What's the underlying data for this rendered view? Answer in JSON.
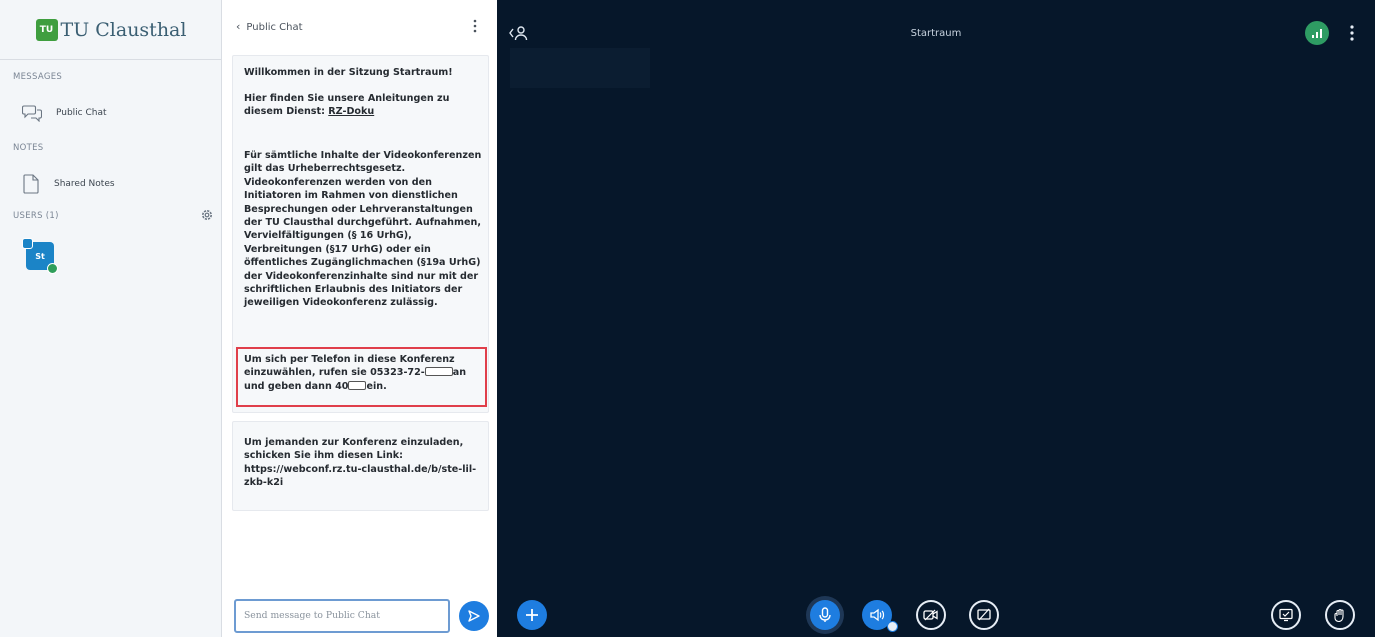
{
  "logo": {
    "mark": "TU",
    "text": "TU Clausthal"
  },
  "sidebar": {
    "messages_title": "MESSAGES",
    "public_chat_label": "Public Chat",
    "notes_title": "NOTES",
    "shared_notes_label": "Shared Notes",
    "users_title": "USERS (1)",
    "user_initials": "St"
  },
  "chat": {
    "back_label": "Public Chat",
    "welcome_prefix": "Willkommen in der Sitzung ",
    "welcome_room": "Startraum!",
    "guide_text": "Hier finden Sie unsere Anleitungen zu diesem Dienst: ",
    "guide_link": "RZ-Doku",
    "legal_text": "Für sämtliche Inhalte der Videokonferenzen gilt das Urheberrechtsgesetz. Videokonferenzen werden von den Initiatoren im Rahmen von dienstlichen Besprechungen oder Lehrveranstaltungen der TU Clausthal durchgeführt. Aufnahmen, Vervielfältigungen (§ 16 UrhG), Verbreitungen (§17 UrhG) oder ein öffentliches Zugänglichmachen (§19a UrhG) der Videokonferenzinhalte sind nur mit der schriftlichen Erlaubnis des Initiators der jeweiligen Videokonferenz zulässig.",
    "dialin_part1": "Um sich per Telefon in diese Konferenz einzuwählen, rufen sie 05323-72-",
    "dialin_part2": "an",
    "dialin_part3": "und geben dann 40",
    "dialin_part4": "ein.",
    "invite_text": "Um jemanden zur Konferenz einzuladen, schicken Sie ihm diesen Link: https://webconf.rz.tu-clausthal.de/b/ste-lil-zkb-k2i",
    "input_placeholder": "Send message to Public Chat"
  },
  "main": {
    "room_title": "Startraum"
  },
  "icons": {
    "users_toggle": "user-icon",
    "connection": "signal-bars-icon",
    "actions": "plus-icon",
    "mic": "microphone-icon",
    "audio": "speaker-icon",
    "camera": "camera-icon",
    "screenshare": "screen-share-icon",
    "presentation": "presentation-icon",
    "raise_hand": "hand-icon"
  },
  "colors": {
    "accent": "#1e7de0",
    "main_bg": "#06172a",
    "panel_bg": "#f3f6f9",
    "highlight": "#e03f4a",
    "status_green": "#2e9c63"
  }
}
